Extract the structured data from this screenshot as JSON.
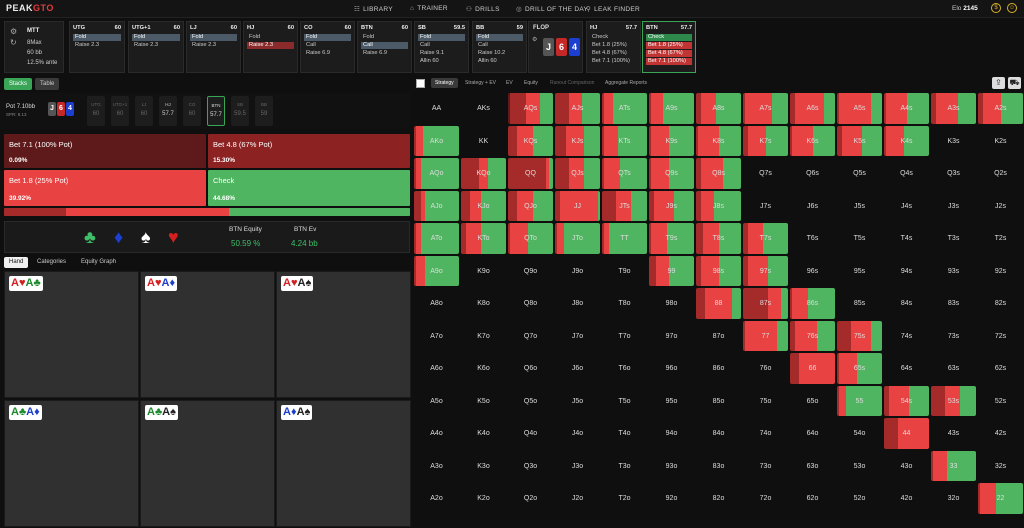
{
  "nav": {
    "logo_a": "PEAK",
    "logo_b": "GTO",
    "items": [
      {
        "icon": "☷",
        "label": "LIBRARY"
      },
      {
        "icon": "⌂",
        "label": "TRAINER"
      },
      {
        "icon": "⚇",
        "label": "DRILLS"
      },
      {
        "icon": "◎",
        "label": "DRILL OF THE DAY"
      },
      {
        "icon": "⚲",
        "label": "LEAK FINDER"
      }
    ],
    "elo_label": "Elo",
    "elo_value": "2145"
  },
  "game": {
    "title": "MTT",
    "players": "8Max",
    "stack": "60 bb",
    "ante": "12.5% ante"
  },
  "seats": [
    {
      "name": "UTG",
      "stack": "60",
      "actions": [
        "Fold",
        "Raise 2.3"
      ],
      "selected": 0,
      "style": "sel"
    },
    {
      "name": "UTG+1",
      "stack": "60",
      "actions": [
        "Fold",
        "Raise 2.3"
      ],
      "selected": 0,
      "style": "sel"
    },
    {
      "name": "LJ",
      "stack": "60",
      "actions": [
        "Fold",
        "Raise 2.3"
      ],
      "selected": 0,
      "style": "sel"
    },
    {
      "name": "HJ",
      "stack": "60",
      "actions": [
        "Fold",
        "Raise 2.3"
      ],
      "selected": 1,
      "style": "selr"
    },
    {
      "name": "CO",
      "stack": "60",
      "actions": [
        "Fold",
        "Call",
        "Raise 6.9"
      ],
      "selected": 0,
      "style": "sel"
    },
    {
      "name": "BTN",
      "stack": "60",
      "actions": [
        "Fold",
        "Call",
        "Raise 6.9"
      ],
      "selected": 1,
      "style": "sel"
    },
    {
      "name": "SB",
      "stack": "59.5",
      "actions": [
        "Fold",
        "Call",
        "Raise 9.1",
        "Allin 60"
      ],
      "selected": 0,
      "style": "sel"
    },
    {
      "name": "BB",
      "stack": "59",
      "actions": [
        "Fold",
        "Call",
        "Raise 10.2",
        "Allin 60"
      ],
      "selected": 0,
      "style": "sel"
    }
  ],
  "flop": {
    "label": "FLOP",
    "cards": [
      "J",
      "6",
      "4"
    ]
  },
  "post": [
    {
      "name": "HJ",
      "stack": "57.7",
      "actions": [
        "Check",
        "Bet 1.8 (25%)",
        "Bet 4.8 (67%)",
        "Bet 7.1 (100%)"
      ]
    },
    {
      "name": "BTN",
      "stack": "57.7",
      "actions": [
        "Check",
        "Bet 1.8 (25%)",
        "Bet 4.8 (67%)",
        "Bet 7.1 (100%)"
      ]
    }
  ],
  "left_tabs": [
    "Stacks",
    "Table"
  ],
  "pot": {
    "label": "Pot",
    "value": "7.10bb",
    "spr": "SPR: 8.13"
  },
  "mini_seats": [
    {
      "n": "UTG",
      "v": "60"
    },
    {
      "n": "UTG+1",
      "v": "60"
    },
    {
      "n": "LJ",
      "v": "60"
    },
    {
      "n": "HJ",
      "v": "57.7"
    },
    {
      "n": "CO",
      "v": "60"
    },
    {
      "n": "BTN",
      "v": "57.7"
    },
    {
      "n": "SB",
      "v": "59.5"
    },
    {
      "n": "BB",
      "v": "59"
    }
  ],
  "actions": [
    {
      "label": "Bet 7.1 (100% Pot)",
      "pct": "0.09%",
      "color": "#5e1a1a"
    },
    {
      "label": "Bet 4.8 (67% Pot)",
      "pct": "15.30%",
      "color": "#8c2222"
    },
    {
      "label": "Bet 1.8 (25% Pot)",
      "pct": "39.92%",
      "color": "#e94242"
    },
    {
      "label": "Check",
      "pct": "44.68%",
      "color": "#4fb560"
    }
  ],
  "freq": [
    0.0009,
    0.153,
    0.3992,
    0.4468
  ],
  "equity": {
    "eq_label": "BTN Equity",
    "eq_value": "50.59 %",
    "ev_label": "BTN Ev",
    "ev_value": "4.24 bb"
  },
  "suits": [
    "♣",
    "♦",
    "♠",
    "♥"
  ],
  "hand_tabs": [
    "Hand",
    "Categories",
    "Equity Graph"
  ],
  "hand_combos": [
    [
      {
        "r": "A",
        "s": "♥",
        "c": "r"
      },
      {
        "r": "A",
        "s": "♣",
        "c": "g"
      }
    ],
    [
      {
        "r": "A",
        "s": "♥",
        "c": "r"
      },
      {
        "r": "A",
        "s": "♦",
        "c": "b"
      }
    ],
    [
      {
        "r": "A",
        "s": "♥",
        "c": "r"
      },
      {
        "r": "A",
        "s": "♠",
        "c": "k"
      }
    ],
    [
      {
        "r": "A",
        "s": "♣",
        "c": "g"
      },
      {
        "r": "A",
        "s": "♦",
        "c": "b"
      }
    ],
    [
      {
        "r": "A",
        "s": "♣",
        "c": "g"
      },
      {
        "r": "A",
        "s": "♠",
        "c": "k"
      }
    ],
    [
      {
        "r": "A",
        "s": "♦",
        "c": "b"
      },
      {
        "r": "A",
        "s": "♠",
        "c": "k"
      }
    ]
  ],
  "right_tabs": [
    "Strategy",
    "Strategy + EV",
    "EV",
    "Equity",
    "Runout Comparison",
    "Aggregate Reports"
  ],
  "ranks": [
    "A",
    "K",
    "Q",
    "J",
    "T",
    "9",
    "8",
    "7",
    "6",
    "5",
    "4",
    "3",
    "2"
  ],
  "grid_colored": {
    "AQs": [
      0.05,
      0.35,
      0.3,
      0.3
    ],
    "AJs": [
      0,
      0.3,
      0.3,
      0.4
    ],
    "ATs": [
      0,
      0.05,
      0.2,
      0.75
    ],
    "A9s": [
      0,
      0.05,
      0.25,
      0.7
    ],
    "A8s": [
      0,
      0.1,
      0.35,
      0.55
    ],
    "A7s": [
      0,
      0.05,
      0.6,
      0.35
    ],
    "A6s": [
      0,
      0.1,
      0.65,
      0.25
    ],
    "A5s": [
      0,
      0.05,
      0.7,
      0.25
    ],
    "A4s": [
      0,
      0.05,
      0.45,
      0.5
    ],
    "A3s": [
      0,
      0.1,
      0.5,
      0.4
    ],
    "A2s": [
      0,
      0.1,
      0.4,
      0.5
    ],
    "AKo": [
      0,
      0.05,
      0.15,
      0.8
    ],
    "KQs": [
      0,
      0.2,
      0.35,
      0.45
    ],
    "KJs": [
      0,
      0.25,
      0.4,
      0.35
    ],
    "KTs": [
      0,
      0.05,
      0.3,
      0.65
    ],
    "K9s": [
      0,
      0.05,
      0.4,
      0.55
    ],
    "K8s": [
      0,
      0.05,
      0.45,
      0.5
    ],
    "K7s": [
      0,
      0.1,
      0.4,
      0.5
    ],
    "K6s": [
      0,
      0.05,
      0.45,
      0.5
    ],
    "K5s": [
      0,
      0.1,
      0.45,
      0.45
    ],
    "K4s": [
      0,
      0.05,
      0.4,
      0.55
    ],
    "AQo": [
      0,
      0.05,
      0.1,
      0.85
    ],
    "KQo": [
      0,
      0.4,
      0.2,
      0.4
    ],
    "QQ": [
      0,
      0.85,
      0.05,
      0.1
    ],
    "QJs": [
      0,
      0.3,
      0.35,
      0.35
    ],
    "QTs": [
      0,
      0.05,
      0.35,
      0.6
    ],
    "Q9s": [
      0,
      0.05,
      0.4,
      0.55
    ],
    "Q8s": [
      0,
      0.1,
      0.5,
      0.4
    ],
    "AJo": [
      0,
      0.15,
      0.1,
      0.75
    ],
    "KJo": [
      0,
      0.2,
      0.25,
      0.55
    ],
    "QJo": [
      0,
      0.2,
      0.35,
      0.45
    ],
    "JJ": [
      0,
      0.1,
      0.85,
      0.05
    ],
    "JTs": [
      0,
      0.3,
      0.35,
      0.35
    ],
    "J9s": [
      0,
      0.1,
      0.45,
      0.45
    ],
    "J8s": [
      0,
      0.1,
      0.3,
      0.6
    ],
    "ATo": [
      0,
      0.05,
      0.1,
      0.85
    ],
    "KTo": [
      0,
      0.1,
      0.35,
      0.55
    ],
    "QTo": [
      0,
      0.05,
      0.4,
      0.55
    ],
    "JTo": [
      0,
      0.05,
      0.15,
      0.8
    ],
    "TT": [
      0,
      0.05,
      0.1,
      0.85
    ],
    "T9s": [
      0,
      0.05,
      0.35,
      0.6
    ],
    "T8s": [
      0,
      0.15,
      0.35,
      0.5
    ],
    "T7s": [
      0,
      0.1,
      0.35,
      0.55
    ],
    "A9o": [
      0,
      0.05,
      0.2,
      0.75
    ],
    "99": [
      0,
      0.15,
      0.3,
      0.55
    ],
    "98s": [
      0,
      0.1,
      0.4,
      0.5
    ],
    "97s": [
      0,
      0.1,
      0.45,
      0.45
    ],
    "88": [
      0,
      0.2,
      0.6,
      0.2
    ],
    "87s": [
      0,
      0.55,
      0.3,
      0.15
    ],
    "86s": [
      0,
      0.05,
      0.35,
      0.6
    ],
    "77": [
      0,
      0.05,
      0.7,
      0.25
    ],
    "76s": [
      0,
      0.1,
      0.5,
      0.4
    ],
    "75s": [
      0,
      0.3,
      0.45,
      0.25
    ],
    "66": [
      0,
      0.2,
      0.8,
      0
    ],
    "65s": [
      0,
      0.05,
      0.4,
      0.55
    ],
    "55": [
      0,
      0.05,
      0.15,
      0.8
    ],
    "54s": [
      0,
      0.1,
      0.45,
      0.45
    ],
    "53s": [
      0,
      0.3,
      0.35,
      0.35
    ],
    "44": [
      0,
      0.3,
      0.7,
      0
    ],
    "33": [
      0,
      0.05,
      0.3,
      0.65
    ],
    "22": [
      0,
      0.05,
      0.35,
      0.6
    ]
  },
  "colors": {
    "bet100": "#5e1a1a",
    "bet67": "#a52a2a",
    "bet25": "#e94242",
    "check": "#4fb560"
  }
}
